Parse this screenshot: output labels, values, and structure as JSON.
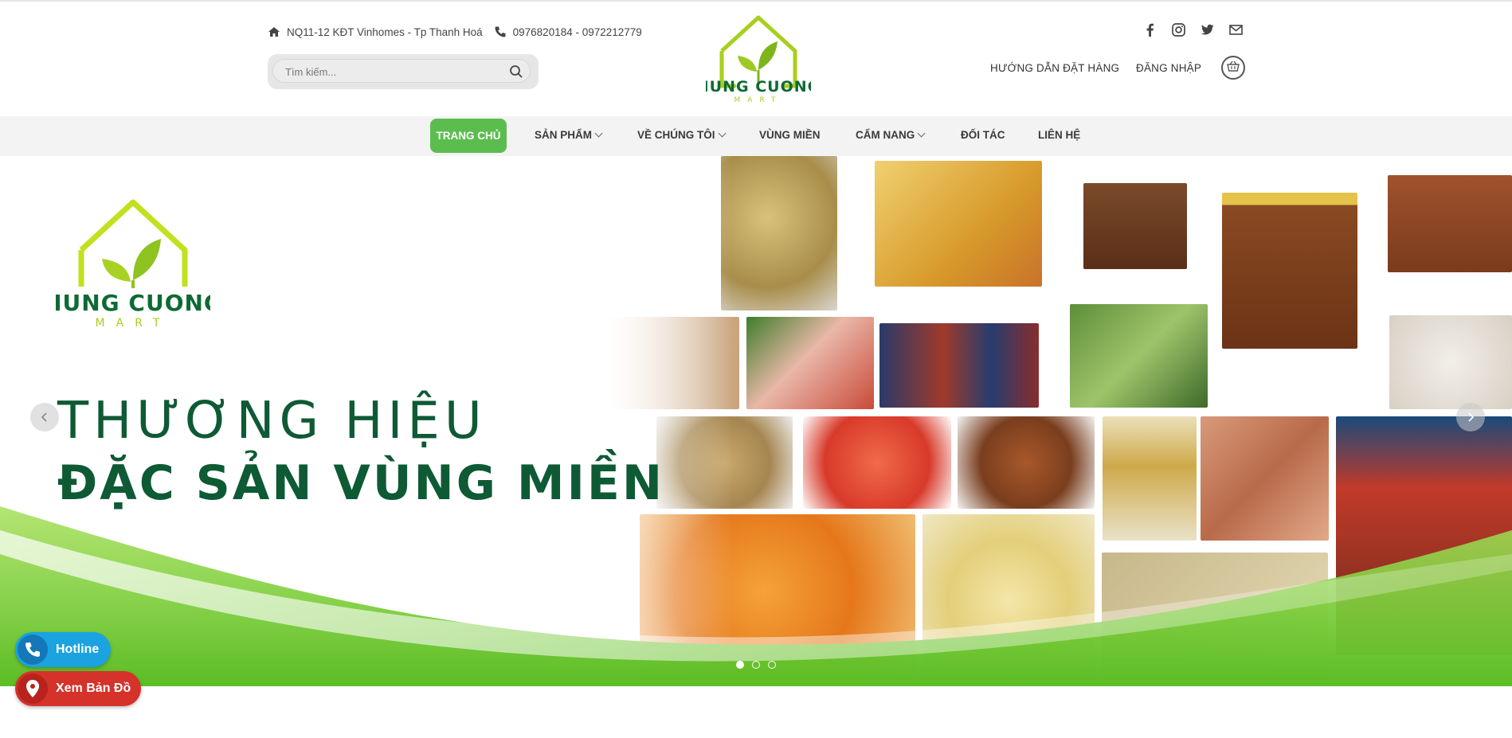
{
  "header": {
    "address": "NQ11-12 KĐT Vinhomes - Tp Thanh Hoá",
    "phone": "0976820184 - 0972212779",
    "search_placeholder": "Tìm kiếm...",
    "order_guide": "HƯỚNG DẪN ĐẶT HÀNG",
    "login": "ĐĂNG NHẬP",
    "socials": [
      "facebook-icon",
      "instagram-icon",
      "twitter-icon",
      "email-icon"
    ]
  },
  "logo": {
    "name": "HUNG CUONG",
    "sub": "MART"
  },
  "nav": {
    "items": [
      {
        "label": "TRANG CHỦ",
        "active": true
      },
      {
        "label": "SẢN PHẨM",
        "dropdown": true
      },
      {
        "label": "VỀ CHÚNG TÔI",
        "dropdown": true
      },
      {
        "label": "VÙNG MIỀN",
        "dropdown": false
      },
      {
        "label": "CẨM NANG",
        "dropdown": true
      },
      {
        "label": "ĐỐI TÁC",
        "dropdown": false
      },
      {
        "label": "LIÊN HỆ",
        "dropdown": false
      }
    ]
  },
  "hero": {
    "line1": "THƯƠNG HIỆU",
    "line2": "ĐẶC SẢN VÙNG MIỀN",
    "slides": 3,
    "active_slide": 1
  },
  "floating": {
    "hotline": "Hotline",
    "map": "Xem Bản Đồ"
  },
  "colors": {
    "brand_green": "#5cbd4f",
    "logo_lime": "#a8cf1e",
    "dark_green": "#0e5a35",
    "hotline_blue": "#1aa3e0",
    "map_red": "#d5322a"
  }
}
